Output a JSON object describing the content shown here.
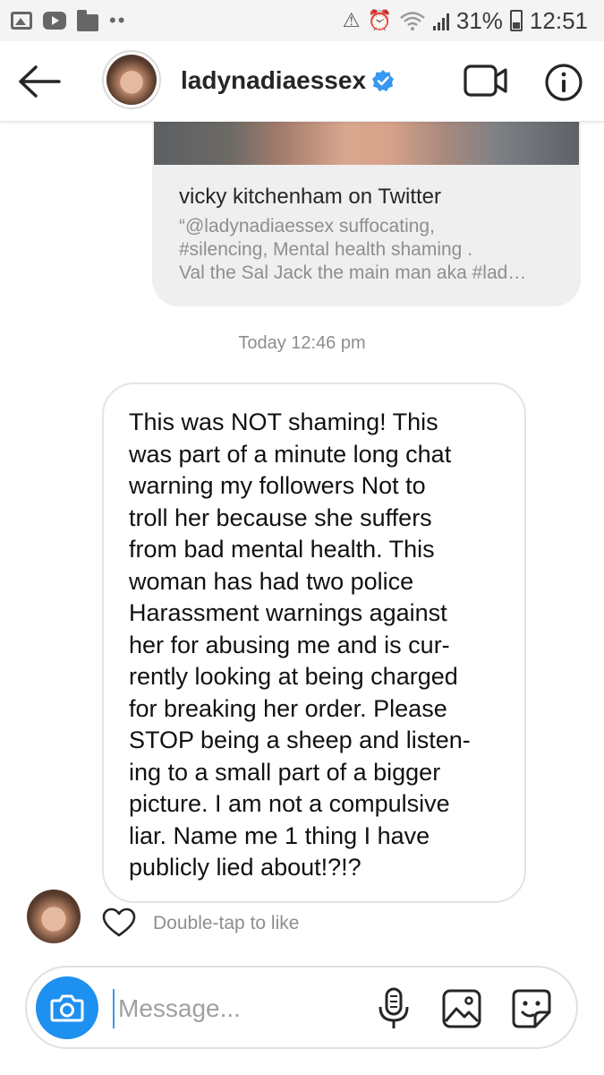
{
  "status_bar": {
    "left_icons": [
      "gallery-icon",
      "youtube-icon",
      "folder-icon",
      "more-dots-icon"
    ],
    "right_icons": [
      "data-saver-icon",
      "alarm-icon",
      "wifi-icon",
      "signal-icon"
    ],
    "battery": "31%",
    "time": "12:51"
  },
  "header": {
    "username": "ladynadiaessex",
    "verified": true,
    "icons": [
      "back-arrow-icon",
      "video-call-icon",
      "info-icon"
    ]
  },
  "shared_link": {
    "title": "vicky kitchenham on Twitter",
    "description_lines": [
      "“@ladynadiaessex suffocating,",
      "#silencing, Mental health shaming .",
      "Val the Sal Jack the main man aka #lad…"
    ]
  },
  "timestamp": "Today 12:46 pm",
  "message": {
    "lines": [
      "This was NOT shaming! This",
      "was part of a minute long chat",
      "warning my followers Not to",
      "troll her because she suffers",
      "from bad mental health. This",
      "woman has had two police",
      "Harassment warnings against",
      "her for abusing me and is cur-",
      "rently looking at being charged",
      "for breaking her order. Please",
      "STOP being a sheep and listen-",
      "ing to a small part of a bigger",
      "picture. I am not a compulsive",
      "liar. Name me 1 thing I have",
      "publicly lied about!?!?"
    ],
    "like_hint": "Double-tap to like"
  },
  "composer": {
    "placeholder": "Message...",
    "icons": [
      "camera-icon",
      "microphone-icon",
      "gallery-icon",
      "sticker-icon"
    ],
    "accent_color": "#1e90f0"
  },
  "colors": {
    "verified_badge": "#3897f0",
    "link_card_bg": "#efefef",
    "secondary_text": "#8e8e8e"
  }
}
